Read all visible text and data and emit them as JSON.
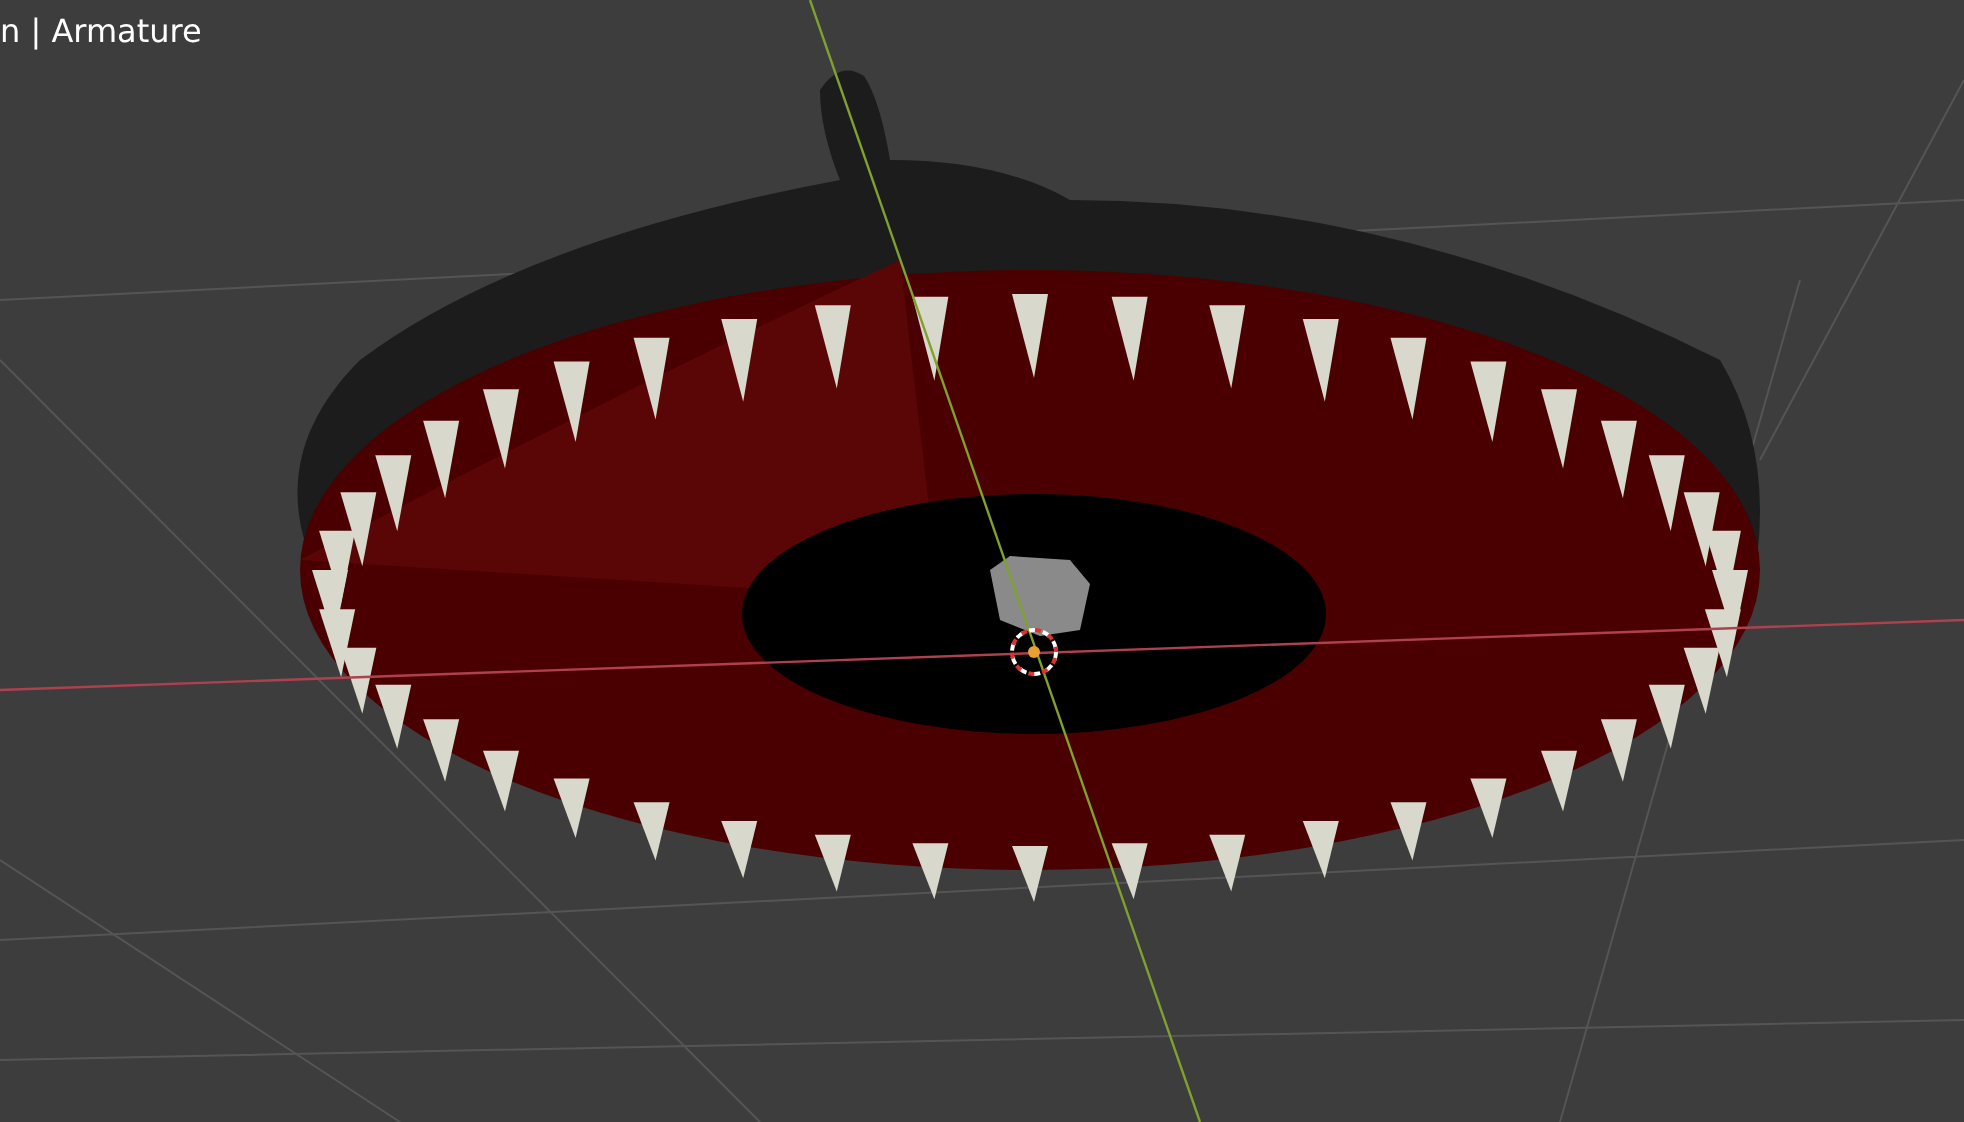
{
  "viewport": {
    "header": "n | Armature"
  }
}
